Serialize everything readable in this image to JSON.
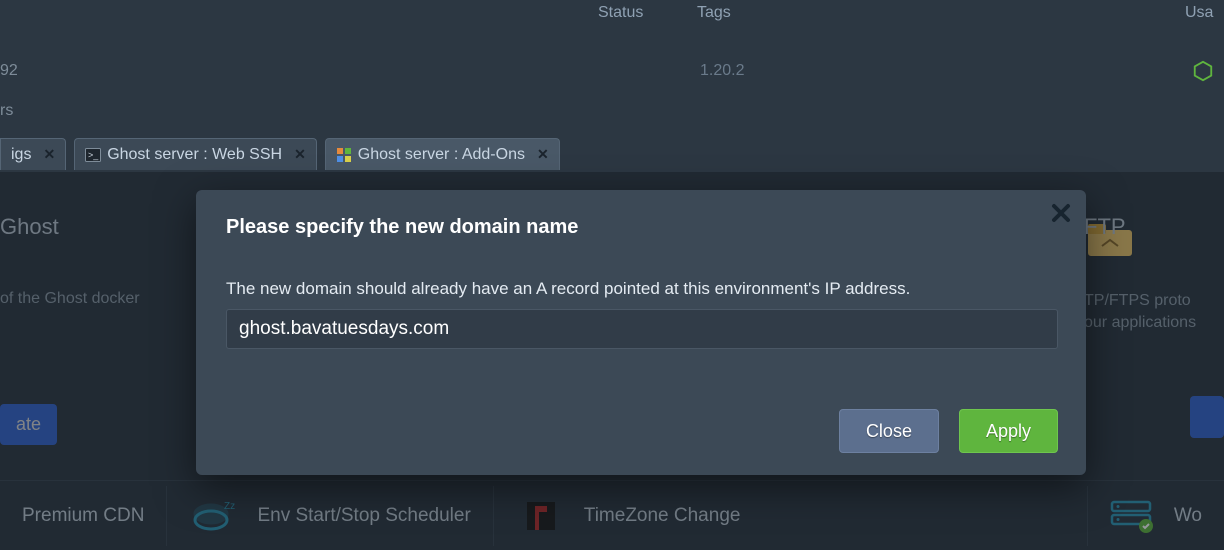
{
  "table": {
    "columns": {
      "status": "Status",
      "tags": "Tags",
      "usage": "Usa"
    },
    "row": {
      "id_fragment": "92",
      "version": "1.20.2"
    },
    "row2_fragment": "rs"
  },
  "tabs": {
    "igs": {
      "label": "igs"
    },
    "ssh": {
      "label": "Ghost server : Web SSH"
    },
    "addons": {
      "label": "Ghost server : Add-Ons"
    }
  },
  "cards": {
    "ghost": {
      "title": "Ghost",
      "desc": "of the Ghost docker",
      "button_fragment": "ate"
    },
    "ftp": {
      "title": "FTP",
      "desc_l1": "TP/FTPS proto",
      "desc_l2": "our applications"
    }
  },
  "bottom": {
    "cdn": "Premium CDN",
    "scheduler": "Env Start/Stop Scheduler",
    "tz": "TimeZone Change",
    "wo": "Wo"
  },
  "modal": {
    "title": "Please specify the new domain name",
    "desc": "The new domain should already have an A record pointed at this environment's IP address.",
    "input_value": "ghost.bavatuesdays.com",
    "close_label": "Close",
    "apply_label": "Apply"
  }
}
